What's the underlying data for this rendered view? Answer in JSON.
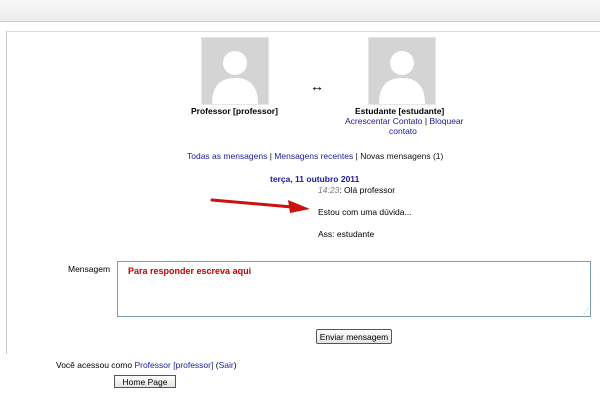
{
  "contacts": {
    "teacher": {
      "name": "Professor [professor]"
    },
    "student": {
      "name": "Estudante [estudante]",
      "add_contact": "Acrescentar Contato",
      "separator": "|",
      "block_line1": "Bloquear",
      "block_line2": "contato"
    },
    "swap_glyph": "↔"
  },
  "message_links": {
    "all": "Todas as mensagens",
    "sep": "|",
    "recent": "Mensagens recentes",
    "new": "Novas mensagens (1)"
  },
  "thread": {
    "date": "terça, 11 outubro 2011",
    "time": "14:23",
    "time_suffix": ":",
    "line1": "Olá professor",
    "line2": "Estou com uma dúvida...",
    "line3": "Ass: estudante"
  },
  "compose": {
    "label": "Mensagem",
    "placeholder": "Para responder escreva aqui",
    "send_button": "Enviar mensagem"
  },
  "footer": {
    "prefix": "Você acessou como",
    "user": "Professor [professor]",
    "logout_open": "(",
    "logout": "Sair",
    "logout_close": ")",
    "home_button": "Home Page"
  },
  "colors": {
    "link": "#1a1a9c",
    "arrow": "#cc1111",
    "placeholder": "#c40000"
  },
  "icons": {
    "avatar": "user-silhouette-icon",
    "annotation": "red-arrow-icon",
    "swap": "double-arrow-icon"
  }
}
